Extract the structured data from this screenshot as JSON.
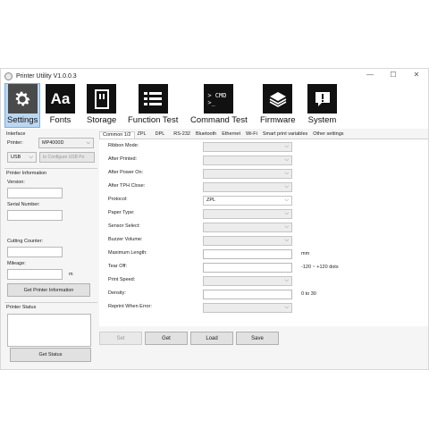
{
  "window": {
    "title": "Printer Utility  V1.0.0.3",
    "minimize": "—",
    "maximize": "☐",
    "close": "✕"
  },
  "toolbar": [
    {
      "label": "Settings",
      "icon": "gear-icon",
      "active": true
    },
    {
      "label": "Fonts",
      "icon": "fonts-icon",
      "glyph": "Aa"
    },
    {
      "label": "Storage",
      "icon": "storage-icon"
    },
    {
      "label": "Function Test",
      "icon": "list-icon"
    },
    {
      "label": "Command Test",
      "icon": "command-prompt-icon",
      "glyph": "> CMD"
    },
    {
      "label": "Firmware",
      "icon": "chip-icon"
    },
    {
      "label": "System",
      "icon": "system-alert-icon"
    }
  ],
  "interface": {
    "group_title": "Interface",
    "printer_label": "Printer:",
    "printer_value": "MP4000D",
    "port_value": "USB",
    "configure_placeholder": "to Configure USB Po"
  },
  "printer_info": {
    "group_title": "Printer Information",
    "version_label": "Version:",
    "serial_label": "Serial Number:",
    "cutting_label": "Cutting Counter:",
    "mileage_label": "Mileage:",
    "mileage_unit": "m",
    "get_info_button": "Get Printer Information"
  },
  "printer_status": {
    "group_title": "Printer Status",
    "get_status_button": "Get Status"
  },
  "tabs": [
    "Common 1/2",
    "ZPL",
    "DPL",
    "RS-232",
    "Bluetooth",
    "Ethernet",
    "Wi-Fi",
    "Smart print variables",
    "Other settings"
  ],
  "settings": [
    {
      "label": "Ribbon Mode:",
      "type": "select",
      "value": ""
    },
    {
      "label": "After Printed:",
      "type": "select",
      "value": ""
    },
    {
      "label": "After Power On:",
      "type": "select",
      "value": ""
    },
    {
      "label": "After TPH Close:",
      "type": "select",
      "value": ""
    },
    {
      "label": "Protocol:",
      "type": "select",
      "value": "ZPL"
    },
    {
      "label": "Paper Type:",
      "type": "select",
      "value": ""
    },
    {
      "label": "Sensor Select:",
      "type": "select",
      "value": ""
    },
    {
      "label": "Buzzer Volume:",
      "type": "select",
      "value": ""
    },
    {
      "label": "Maximum Length:",
      "type": "text",
      "value": "",
      "hint": "mm"
    },
    {
      "label": "Tear Off:",
      "type": "text",
      "value": "",
      "hint": "-120 ~ +120 dots"
    },
    {
      "label": "Print Speed:",
      "type": "select",
      "value": ""
    },
    {
      "label": "Density:",
      "type": "text",
      "value": "",
      "hint": "0 to 30"
    },
    {
      "label": "Reprint When Error:",
      "type": "select",
      "value": ""
    }
  ],
  "actions": {
    "set": "Set",
    "get": "Get",
    "load": "Load",
    "save": "Save"
  }
}
